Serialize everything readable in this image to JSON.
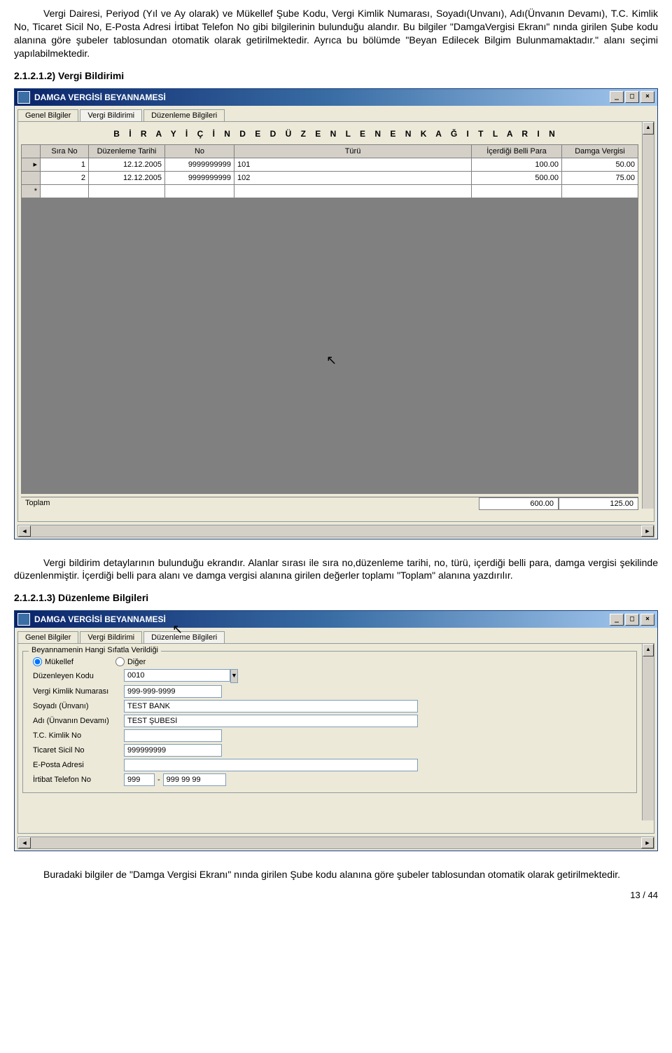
{
  "para1": "Vergi Dairesi, Periyod (Yıl ve Ay olarak) ve Mükellef Şube Kodu, Vergi Kimlik Numarası, Soyadı(Unvanı), Adı(Ünvanın Devamı), T.C. Kimlik No, Ticaret Sicil No, E-Posta Adresi İrtibat Telefon No gibi bilgilerinin bulunduğu alandır. Bu bilgiler \"DamgaVergisi Ekranı\" nında girilen Şube kodu alanına göre şubeler tablosundan otomatik olarak getirilmektedir. Ayrıca bu bölümde \"Beyan Edilecek Bilgim Bulunmamaktadır.\" alanı seçimi yapılabilmektedir.",
  "heading1": "2.1.2.1.2)  Vergi Bildirimi",
  "window1": {
    "title": "DAMGA VERGİSİ BEYANNAMESİ",
    "tabs": [
      "Genel Bilgiler",
      "Vergi Bildirimi",
      "Düzenleme Bilgileri"
    ],
    "active_tab": 1,
    "grid_title": "B İ R  A Y  İ Ç İ N D E  D Ü Z E N L E N E N  K A Ğ I T L A R I N",
    "columns": [
      "Sıra No",
      "Düzenleme Tarihi",
      "No",
      "Türü",
      "İçerdiği Belli Para",
      "Damga Vergisi"
    ],
    "rows": [
      {
        "sira": "1",
        "tarih": "12.12.2005",
        "no": "9999999999",
        "turu": "101",
        "para": "100.00",
        "vergi": "50.00"
      },
      {
        "sira": "2",
        "tarih": "12.12.2005",
        "no": "9999999999",
        "turu": "102",
        "para": "500.00",
        "vergi": "75.00"
      }
    ],
    "totals_label": "Toplam",
    "total_para": "600.00",
    "total_vergi": "125.00"
  },
  "para2": "Vergi bildirim detaylarının bulunduğu ekrandır. Alanlar sırası ile sıra no,düzenleme tarihi, no, türü, içerdiği belli para, damga vergisi şekilinde düzenlenmiştir. İçerdiği belli para  alanı ve damga vergisi alanına girilen değerler toplamı \"Toplam\" alanına yazdırılır.",
  "heading2": "2.1.2.1.3)  Düzenleme Bilgileri",
  "window2": {
    "title": "DAMGA VERGİSİ BEYANNAMESİ",
    "tabs": [
      "Genel Bilgiler",
      "Vergi Bildirimi",
      "Düzenleme Bilgileri"
    ],
    "active_tab": 2,
    "group_title": "Beyannamenin Hangi Sıfatla Verildiği",
    "radios": {
      "mukellef": "Mükellef",
      "diger": "Diğer"
    },
    "fields": {
      "duzenleyen_kodu": {
        "label": "Düzenleyen Kodu",
        "value": "0010"
      },
      "vkn": {
        "label": "Vergi Kimlik Numarası",
        "value": "999-999-9999"
      },
      "soyadi": {
        "label": "Soyadı (Ünvanı)",
        "value": "TEST BANK"
      },
      "adi": {
        "label": "Adı (Ünvanın Devamı)",
        "value": "TEST ŞUBESİ"
      },
      "tckimlik": {
        "label": "T.C. Kimlik No",
        "value": ""
      },
      "ticaret": {
        "label": "Ticaret Sicil No",
        "value": "999999999"
      },
      "eposta": {
        "label": "E-Posta Adresi",
        "value": ""
      },
      "telefon": {
        "label": "İrtibat Telefon No",
        "alan": "999",
        "no": "999 99 99"
      }
    }
  },
  "para3": "Buradaki bilgiler de \"Damga Vergisi Ekranı\" nında girilen Şube kodu alanına göre şubeler tablosundan otomatik olarak getirilmektedir.",
  "page_footer": "13 / 44"
}
